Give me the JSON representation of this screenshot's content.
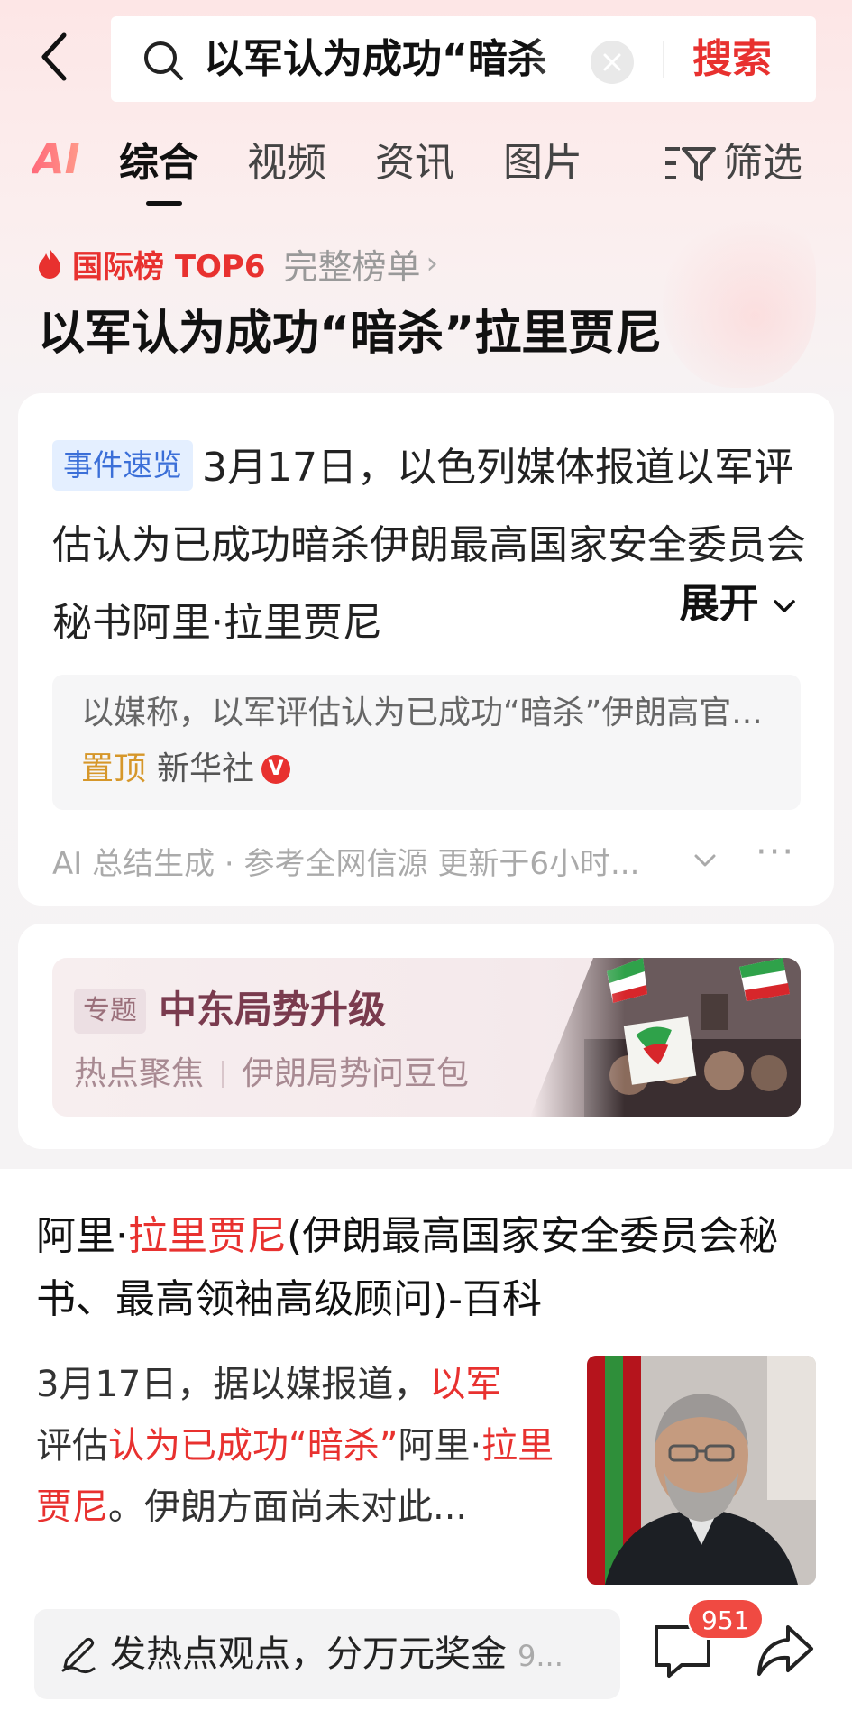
{
  "header": {
    "query": "以军认为成功“暗杀",
    "search_label": "搜索"
  },
  "tabs": {
    "ai_label": "AI",
    "items": [
      "综合",
      "视频",
      "资讯",
      "图片"
    ],
    "active": "综合",
    "filter_label": "筛选"
  },
  "hot_rank": {
    "label": "国际榜 TOP6",
    "full_list": "完整榜单"
  },
  "headline": "以军认为成功“暗杀”拉里贾尼",
  "summary_card": {
    "tag": "事件速览",
    "text": "3月17日，以色列媒体报道以军评估认为已成功暗杀伊朗最高国家安全委员会秘书阿里·拉里贾尼",
    "expand_label": "展开",
    "quote": "以媒称，以军评估认为已成功“暗杀”伊朗高官...",
    "pin_label": "置顶",
    "source": "新华社",
    "verified_badge": "V",
    "footer": "AI 总结生成 · 参考全网信源 更新于6小时..."
  },
  "topic_card": {
    "tag": "专题",
    "title": "中东局势升级",
    "sub1": "热点聚焦",
    "sub2": "伊朗局势问豆包"
  },
  "result": {
    "title_part1": "阿里·",
    "title_hl": "拉里贾尼",
    "title_part2": "(伊朗最高国家安全委员会秘书、最高领袖高级顾问)-百科",
    "body_part1": "3月17日，据以媒报道，",
    "body_hl1": "以军",
    "body_part2": "评估",
    "body_hl2": "认为已成功“暗杀”",
    "body_part3": "阿里·",
    "body_hl3": "拉里贾尼",
    "body_part4": "。伊朗方面尚未对此..."
  },
  "bottom_bar": {
    "placeholder": "发热点观点，分万元奖金",
    "suffix": "9...",
    "comment_count": "951"
  },
  "colors": {
    "accent": "#e8312f",
    "tag_blue": "#3b6fd8",
    "topic": "#7a3b4e"
  }
}
